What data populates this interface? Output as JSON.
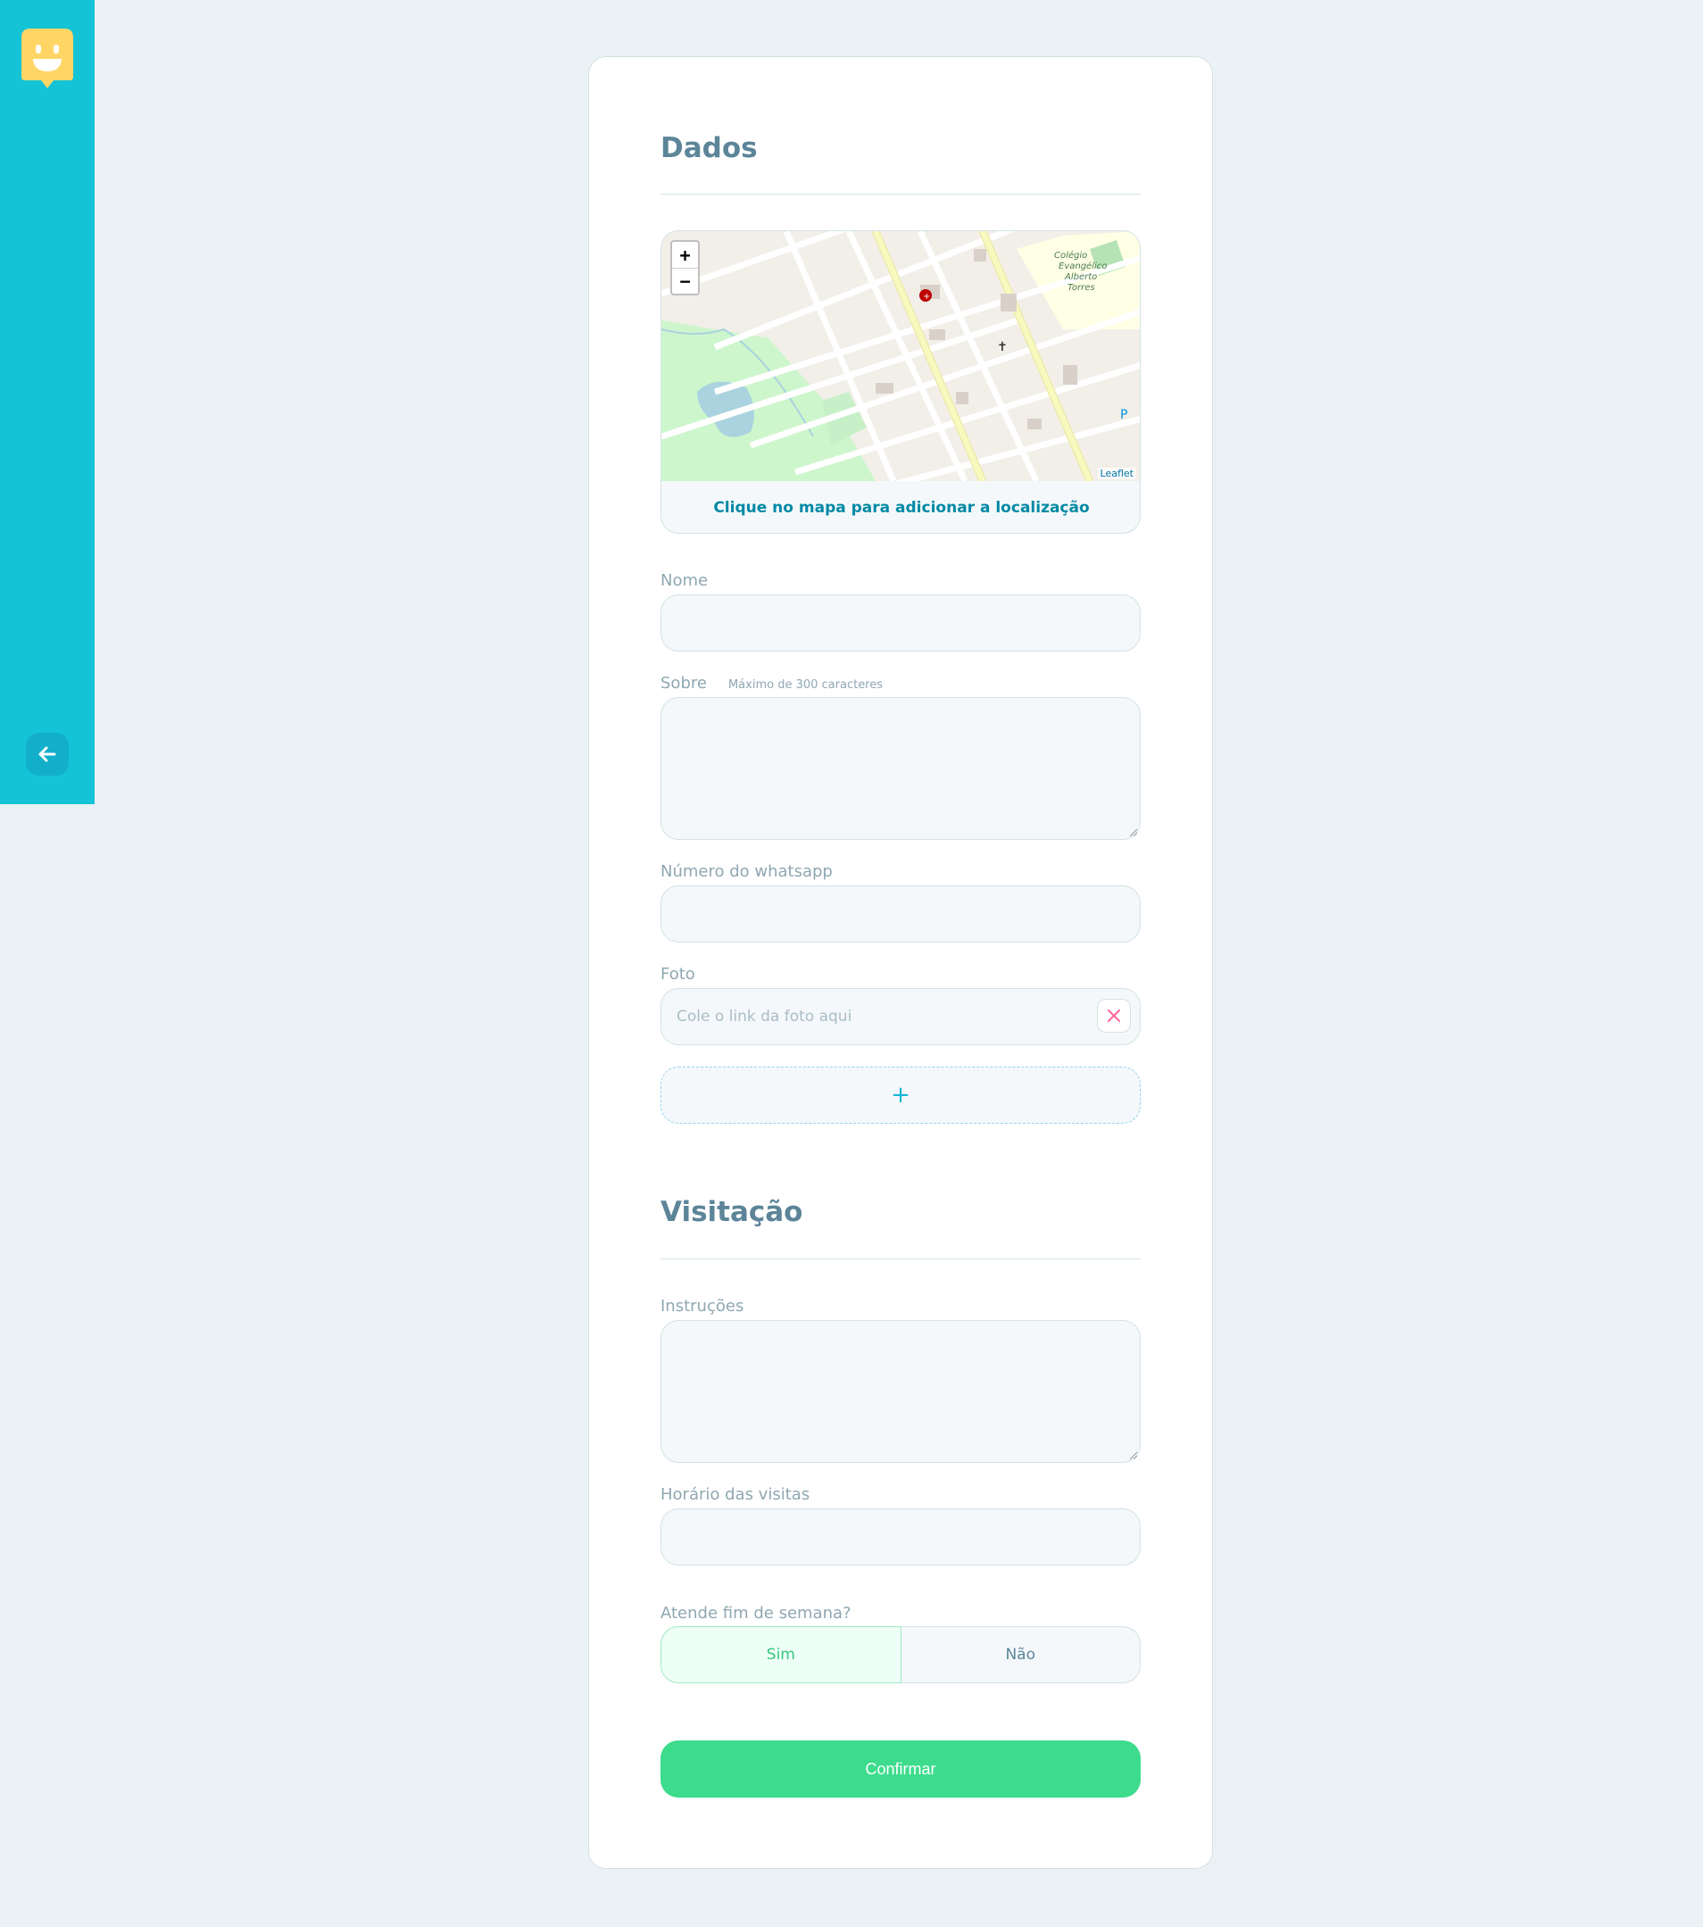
{
  "sidebar": {
    "logo_icon": "smiley-pin-icon",
    "back_icon": "arrow-left-icon"
  },
  "dados": {
    "title": "Dados",
    "map": {
      "zoom_in": "+",
      "zoom_out": "−",
      "attribution": "Leaflet",
      "caption": "Clique no mapa para adicionar a localização"
    },
    "nome_label": "Nome",
    "sobre_label": "Sobre",
    "sobre_hint": "Máximo de 300 caracteres",
    "whatsapp_label": "Número do whatsapp",
    "foto_label": "Foto",
    "foto_placeholder": "Cole o link da foto aqui",
    "add_label": "+"
  },
  "visitacao": {
    "title": "Visitação",
    "instrucoes_label": "Instruções",
    "horario_label": "Horário das visitas",
    "weekend_label": "Atende fim de semana?",
    "yes": "Sim",
    "no": "Não"
  },
  "confirm": "Confirmar",
  "colors": {
    "sidebar": "#15c3d6",
    "confirm": "#3cdc8c",
    "title": "#5c8599"
  }
}
